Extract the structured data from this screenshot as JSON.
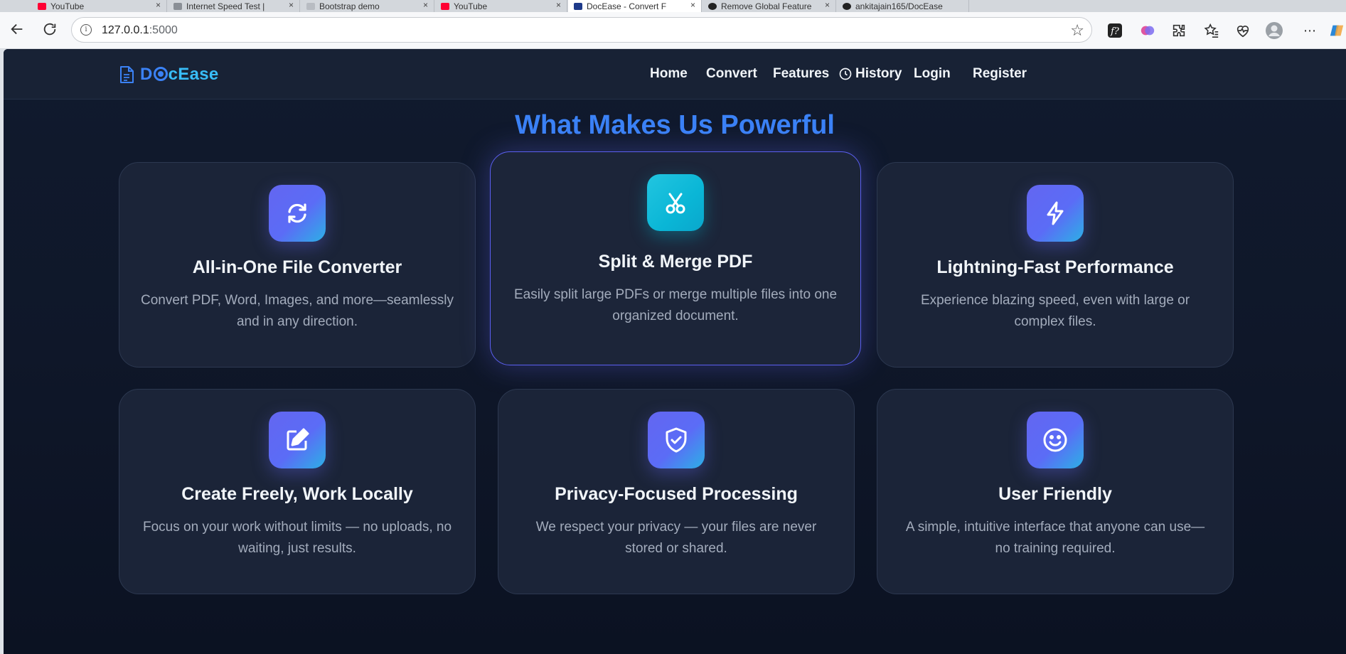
{
  "browser": {
    "tabs": [
      {
        "label": "YouTube",
        "color": "#ff0033"
      },
      {
        "label": "Internet Speed Test |",
        "color": "#8a8f96"
      },
      {
        "label": "Bootstrap demo",
        "color": "#b8bcc2"
      },
      {
        "label": "YouTube",
        "color": "#ff0033"
      },
      {
        "label": "DocEase - Convert F",
        "color": "#1e3a8a"
      },
      {
        "label": "Remove Global Feature",
        "color": "#222222"
      },
      {
        "label": "ankitajain165/DocEase",
        "color": "#222222"
      }
    ],
    "url_host": "127.0.0.1",
    "url_port": ":5000"
  },
  "site": {
    "brand_first": "D",
    "brand_rest": "cEase",
    "nav": {
      "home": "Home",
      "convert": "Convert",
      "features": "Features",
      "history": "History",
      "login": "Login",
      "register": "Register"
    },
    "section_title": "What Makes Us Powerful",
    "features": [
      {
        "title": "All-in-One File Converter",
        "desc": "Convert PDF, Word, Images, and more—seamlessly and in any direction.",
        "icon": "sync-icon"
      },
      {
        "title": "Split & Merge PDF",
        "desc": "Easily split large PDFs or merge multiple files into one organized document.",
        "icon": "scissors-icon"
      },
      {
        "title": "Lightning-Fast Performance",
        "desc": "Experience blazing speed, even with large or complex files.",
        "icon": "lightning-icon"
      },
      {
        "title": "Create Freely, Work Locally",
        "desc": "Focus on your work without limits — no uploads, no waiting, just results.",
        "icon": "edit-icon"
      },
      {
        "title": "Privacy-Focused Processing",
        "desc": "We respect your privacy — your files are never stored or shared.",
        "icon": "shield-check-icon"
      },
      {
        "title": "User Friendly",
        "desc": "A simple, intuitive interface that anyone can use—no training required.",
        "icon": "smile-icon"
      }
    ]
  },
  "colors": {
    "accent": "#3b82f6",
    "accent_cyan": "#38bdf8",
    "page_bg": "#0f1729",
    "card_bg": "#1b2438"
  }
}
